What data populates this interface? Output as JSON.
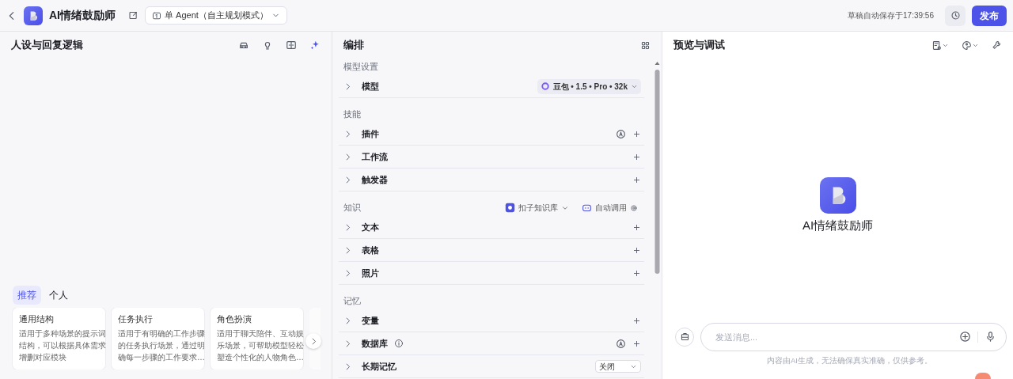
{
  "header": {
    "title": "AI情绪鼓励师",
    "mode": "单 Agent（自主规划模式）",
    "autosave": "草稿自动保存于17:39:56",
    "publish": "发布"
  },
  "persona_panel": {
    "title": "人设与回复逻辑",
    "template_tabs": [
      {
        "label": "推荐",
        "selected": true
      },
      {
        "label": "个人",
        "selected": false
      }
    ],
    "templates": [
      {
        "title": "通用结构",
        "desc": "适用于多种场景的提示词结构，可以根据具体需求增删对应模块"
      },
      {
        "title": "任务执行",
        "desc": "适用于有明确的工作步骤的任务执行场景，通过明确每一步骤的工作要求…"
      },
      {
        "title": "角色扮演",
        "desc": "适用于聊天陪伴、互动娱乐场景，可帮助模型轻松塑造个性化的人物角色…"
      }
    ]
  },
  "arrange_panel": {
    "title": "编排",
    "groups": [
      {
        "title": "模型设置",
        "rows": [
          {
            "label": "模型",
            "kind": "model",
            "value": "豆包 • 1.5 • Pro • 32k",
            "info": false
          }
        ]
      },
      {
        "title": "技能",
        "rows": [
          {
            "label": "插件",
            "kind": "auto-add",
            "info": false
          },
          {
            "label": "工作流",
            "kind": "add",
            "info": false
          },
          {
            "label": "触发器",
            "kind": "add",
            "info": false
          }
        ]
      },
      {
        "title": "知识",
        "source": "扣子知识库",
        "mode": "自动调用",
        "rows": [
          {
            "label": "文本",
            "kind": "add",
            "info": false
          },
          {
            "label": "表格",
            "kind": "add",
            "info": false
          },
          {
            "label": "照片",
            "kind": "add",
            "info": false
          }
        ]
      },
      {
        "title": "记忆",
        "rows": [
          {
            "label": "变量",
            "kind": "add",
            "info": false
          },
          {
            "label": "数据库",
            "kind": "auto-add",
            "info": true
          },
          {
            "label": "长期记忆",
            "kind": "select",
            "value": "关闭",
            "info": false
          }
        ]
      }
    ]
  },
  "preview_panel": {
    "title": "预览与调试",
    "bot_name": "AI情绪鼓励师",
    "input": {
      "placeholder": "发送消息..."
    },
    "disclaimer": "内容由AI生成，无法确保真实准确，仅供参考。"
  }
}
